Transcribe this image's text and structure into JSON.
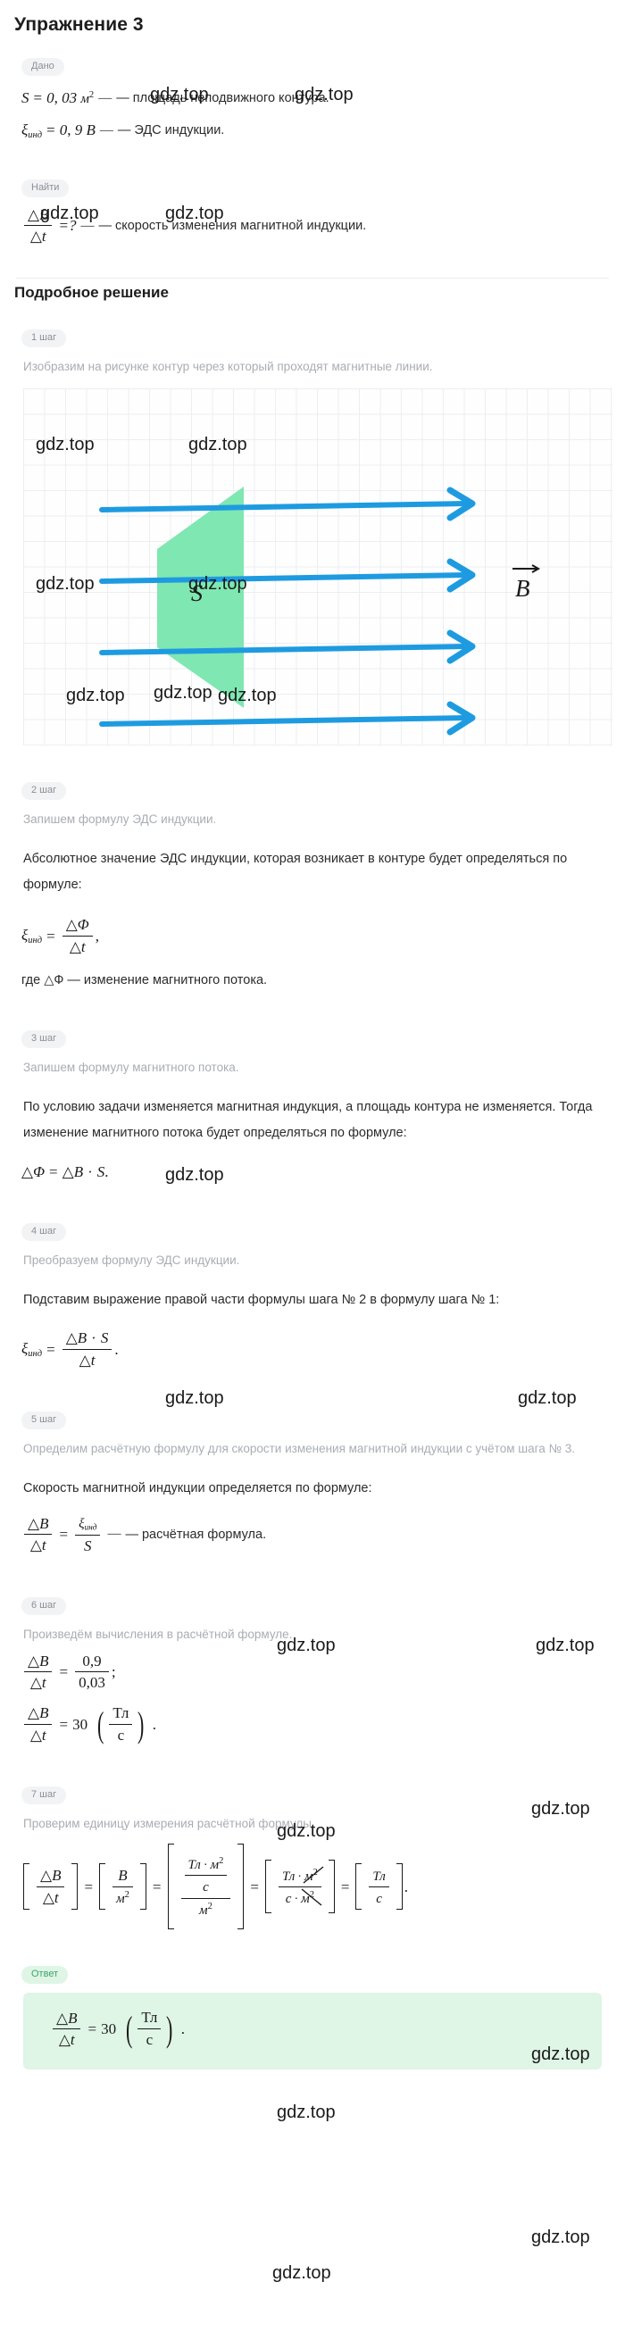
{
  "title": "Упражнение 3",
  "labels": {
    "given": "Дано",
    "find": "Найти",
    "solution_header": "Подробное решение",
    "answer": "Ответ"
  },
  "given": [
    {
      "math": "S = 0,03 м²",
      "text": "— площадь неподвижного контура."
    },
    {
      "math": "ξинд = 0,9 В",
      "text": "— ЭДС индукции."
    }
  ],
  "find": {
    "math": "△B/△t = ?",
    "text": "— скорость изменения магнитной индукции."
  },
  "steps": [
    {
      "badge": "1 шаг",
      "note": "Изобразим на рисунке контур через который проходят магнитные линии.",
      "figure": {
        "area_label": "S",
        "vector_label": "B",
        "field_line_count": 4,
        "contour_color": "#7fe7b2",
        "arrow_color": "#1e9be0",
        "grid_color": "#eceef1"
      }
    },
    {
      "badge": "2 шаг",
      "note": "Запишем формулу ЭДС индукции.",
      "text": "Абсолютное значение ЭДС индукции, которая возникает в контуре будет определяться по формуле:",
      "formula": "ξинд = △Ф / △t ,",
      "after": "где △Ф — изменение магнитного потока."
    },
    {
      "badge": "3 шаг",
      "note": "Запишем формулу магнитного потока.",
      "text": "По условию задачи изменяется магнитная индукция, а площадь контура не изменяется. Тогда изменение магнитного потока будет определяться по формуле:",
      "formula": "△Ф = △B · S."
    },
    {
      "badge": "4 шаг",
      "note": "Преобразуем формулу ЭДС индукции.",
      "text": "Подставим выражение правой части формулы шага № 2 в формулу шага № 1:",
      "formula": "ξинд = △B · S / △t ."
    },
    {
      "badge": "5 шаг",
      "note": "Определим расчётную формулу для скорости изменения магнитной индукции с учётом шага № 3.",
      "text": "Скорость магнитной индукции определяется по формуле:",
      "formula": "△B/△t = ξинд / S — расчётная формула.",
      "formula_tail": "— расчётная формула."
    },
    {
      "badge": "6 шаг",
      "note": "Произведём вычисления в расчётной формуле.",
      "formula1": "△B/△t = 0,9 / 0,03 ;",
      "formula2": "△B/△t = 30 (Тл/с).",
      "values": {
        "emf": "0,9",
        "area": "0,03",
        "result": "30",
        "unit_num": "Тл",
        "unit_den": "с"
      }
    },
    {
      "badge": "7 шаг",
      "note": "Проверим единицу измерения расчётной формулы.",
      "formula": "[△B/△t] = [B/м²] = [(Тл·м²/с)/м²] = [Тл·м²/(с·м²)] = [Тл/с].",
      "units": {
        "B": "В",
        "m2": "м",
        "Tl": "Тл",
        "s": "с"
      }
    }
  ],
  "answer": {
    "formula": "△B/△t = 30 (Тл/с)."
  },
  "symbols": {
    "delta": "△",
    "xi": "ξ",
    "phi": "Φ",
    "ind": "инд",
    "dot": "·",
    "equals": "=",
    "question": "?",
    "dash": "—",
    "comma": ",",
    "period": ".",
    "semicolon": ";",
    "S": "S",
    "B": "B",
    "t": "t",
    "m": "м",
    "two": "2"
  },
  "watermark": {
    "text": "gdz.top"
  }
}
